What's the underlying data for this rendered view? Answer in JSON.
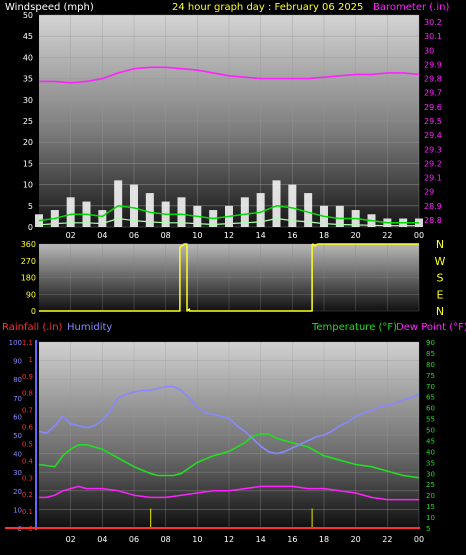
{
  "header": {
    "left": "Windspeed (mph)",
    "center": "24 hour graph day : February 06 2025",
    "right": "Barometer (.in)"
  },
  "colors": {
    "windspeed": "#ffffff",
    "wind_avg": "#00dd00",
    "wind_min": "#aaffaa",
    "barometer": "#ff22ff",
    "direction": "#ffff22",
    "rainfall": "#ff3030",
    "humidity": "#8888ff",
    "temperature": "#22dd22",
    "dewpoint": "#ff22ff",
    "rain_ticks": "#c8c800"
  },
  "chart_data": [
    {
      "type": "line",
      "title": "24 hour graph day : February 06 2025",
      "ylabel": "Windspeed (mph)",
      "y2label": "Barometer (.in)",
      "xlim": [
        0,
        24
      ],
      "ylim": [
        0,
        50
      ],
      "y2lim": [
        28.75,
        30.25
      ],
      "x_ticks": [
        "02",
        "04",
        "06",
        "08",
        "10",
        "12",
        "14",
        "16",
        "18",
        "20",
        "22",
        "00"
      ],
      "y_ticks": [
        0,
        5,
        10,
        15,
        20,
        25,
        30,
        35,
        40,
        45,
        50
      ],
      "y2_ticks": [
        "28.8",
        "28.9",
        "29",
        "29.1",
        "29.2",
        "29.3",
        "29.4",
        "29.5",
        "29.6",
        "29.7",
        "29.8",
        "29.9",
        "30",
        "30.1",
        "30.2"
      ],
      "grid": true,
      "series": [
        {
          "name": "Windspeed (mph)",
          "axis": "y",
          "style": "bars",
          "x": [
            0,
            1,
            2,
            3,
            4,
            5,
            6,
            7,
            8,
            9,
            10,
            11,
            12,
            13,
            14,
            15,
            16,
            17,
            18,
            19,
            20,
            21,
            22,
            23,
            24
          ],
          "values": [
            3,
            4,
            7,
            6,
            4,
            11,
            10,
            8,
            6,
            7,
            5,
            4,
            5,
            7,
            8,
            11,
            10,
            8,
            5,
            5,
            4,
            3,
            2,
            2,
            2
          ]
        },
        {
          "axis": "y",
          "style": "line",
          "x": [
            0,
            1,
            2,
            3,
            4,
            5,
            6,
            7,
            8,
            9,
            10,
            11,
            12,
            13,
            14,
            15,
            16,
            17,
            18,
            19,
            20,
            21,
            22,
            23,
            24
          ],
          "values": [
            1.5,
            2,
            3,
            3,
            2.5,
            5,
            4.5,
            3.5,
            3,
            3,
            2.5,
            2,
            2.5,
            3,
            3.5,
            5,
            4.5,
            3.5,
            2.5,
            2,
            2,
            1.5,
            1,
            1,
            1
          ]
        },
        {
          "axis": "y",
          "style": "line",
          "x": [
            0,
            1,
            2,
            3,
            4,
            5,
            6,
            7,
            8,
            9,
            10,
            11,
            12,
            13,
            14,
            15,
            16,
            17,
            18,
            19,
            20,
            21,
            22,
            23,
            24
          ],
          "values": [
            0.5,
            0.8,
            1,
            1,
            0.8,
            2,
            1.5,
            1.2,
            1,
            1,
            0.8,
            0.6,
            0.8,
            1,
            1.2,
            2,
            1.5,
            1.2,
            0.8,
            0.6,
            0.5,
            0.4,
            0.3,
            0.3,
            0.3
          ]
        },
        {
          "name": "Barometer (.in)",
          "axis": "y2",
          "style": "line",
          "x": [
            0,
            1,
            2,
            3,
            4,
            5,
            6,
            7,
            8,
            9,
            10,
            11,
            12,
            13,
            14,
            15,
            16,
            17,
            18,
            19,
            20,
            21,
            22,
            23,
            24
          ],
          "values": [
            29.78,
            29.78,
            29.77,
            29.78,
            29.8,
            29.84,
            29.87,
            29.88,
            29.88,
            29.87,
            29.86,
            29.84,
            29.82,
            29.81,
            29.8,
            29.8,
            29.8,
            29.8,
            29.81,
            29.82,
            29.83,
            29.83,
            29.84,
            29.84,
            29.83
          ]
        }
      ]
    },
    {
      "type": "line",
      "xlim": [
        0,
        24
      ],
      "ylim": [
        0,
        360
      ],
      "y_ticks": [
        0,
        90,
        180,
        270,
        360
      ],
      "compass_labels": [
        "N",
        "W",
        "S",
        "E",
        "N"
      ],
      "grid": true,
      "series": [
        {
          "axis": "y",
          "style": "step",
          "x": [
            0,
            8.9,
            8.9,
            9.0,
            9.15,
            9.15,
            9.35,
            9.35,
            9.5,
            9.5,
            17.25,
            17.25,
            17.3,
            17.4,
            17.6,
            17.6,
            24
          ],
          "values": [
            0,
            0,
            340,
            350,
            355,
            360,
            360,
            0,
            10,
            0,
            0,
            355,
            360,
            350,
            360,
            360,
            360
          ]
        }
      ]
    },
    {
      "type": "line",
      "xlim": [
        0,
        24
      ],
      "x_ticks": [
        "02",
        "04",
        "06",
        "08",
        "10",
        "12",
        "14",
        "16",
        "18",
        "20",
        "22",
        "00"
      ],
      "rain_label": "Rainfall (.in)",
      "humidity_label": "Humidity",
      "temp_label": "Temperature (°F)",
      "dew_label": "Dew Point (°F)",
      "rain_ylim": [
        0,
        1.1
      ],
      "rain_ticks": [
        "0",
        "0.1",
        "0.2",
        "0.3",
        "0.4",
        "0.5",
        "0.6",
        "0.7",
        "0.8",
        "0.9",
        "1",
        "1.1"
      ],
      "hum_ylim": [
        0,
        100
      ],
      "hum_ticks": [
        0,
        10,
        20,
        30,
        40,
        50,
        60,
        70,
        80,
        90,
        100
      ],
      "temp_ylim": [
        5,
        90
      ],
      "temp_ticks": [
        5,
        10,
        15,
        20,
        25,
        30,
        35,
        40,
        45,
        50,
        55,
        60,
        65,
        70,
        75,
        80,
        85,
        90
      ],
      "grid": true,
      "series": [
        {
          "name": "Humidity",
          "axis": "humidity",
          "style": "line",
          "x": [
            0,
            0.5,
            1,
            1.5,
            2,
            2.5,
            3,
            3.5,
            4,
            4.5,
            5,
            5.5,
            6,
            6.5,
            7,
            7.5,
            8,
            8.5,
            9,
            9.5,
            10,
            10.5,
            11,
            11.5,
            12,
            12.5,
            13,
            13.5,
            14,
            14.5,
            15,
            15.5,
            16,
            16.5,
            17,
            17.5,
            18,
            18.5,
            19,
            19.5,
            20,
            20.5,
            21,
            21.5,
            22,
            22.5,
            23,
            23.5,
            24
          ],
          "values": [
            52,
            51,
            55,
            60,
            56,
            55,
            54,
            55,
            58,
            63,
            70,
            72,
            73,
            74,
            74,
            75,
            76,
            76,
            74,
            70,
            65,
            62,
            61,
            60,
            59,
            55,
            52,
            48,
            44,
            41,
            40,
            41,
            43,
            45,
            47,
            49,
            50,
            52,
            55,
            57,
            60,
            62,
            63,
            65,
            66,
            67,
            69,
            70,
            72
          ]
        },
        {
          "name": "Temperature (°F)",
          "axis": "temp",
          "style": "line",
          "x": [
            0,
            1,
            1.5,
            2,
            2.5,
            3,
            4,
            5,
            6,
            7,
            7.5,
            8,
            8.5,
            9,
            10,
            11,
            12,
            13,
            13.5,
            14,
            14.5,
            15,
            16,
            17,
            18,
            19,
            20,
            21,
            22,
            23,
            24
          ],
          "values": [
            34,
            33,
            38,
            41,
            43,
            43,
            41,
            37,
            33,
            30,
            29,
            29,
            29,
            30,
            35,
            38,
            40,
            44,
            47,
            48,
            48,
            46,
            44,
            42,
            38,
            36,
            34,
            33,
            31,
            29,
            28
          ]
        },
        {
          "name": "Dew Point (°F)",
          "axis": "temp",
          "style": "line",
          "x": [
            0,
            0.5,
            1,
            1.5,
            2,
            2.5,
            3,
            4,
            5,
            6,
            7,
            8,
            9,
            10,
            11,
            12,
            13,
            14,
            15,
            16,
            17,
            18,
            19,
            20,
            21,
            22,
            23,
            24
          ],
          "values": [
            19,
            19,
            20,
            22,
            23,
            24,
            23,
            23,
            22,
            20,
            19,
            19,
            20,
            21,
            22,
            22,
            23,
            24,
            24,
            24,
            23,
            23,
            22,
            21,
            19,
            18,
            18,
            18
          ]
        },
        {
          "name": "Rainfall (.in)",
          "axis": "rain",
          "style": "line",
          "x": [
            0,
            24
          ],
          "values": [
            0,
            0
          ]
        }
      ],
      "rain_events": [
        {
          "x": 7.05,
          "value": 0.08
        },
        {
          "x": 17.25,
          "value": 0.08
        }
      ]
    }
  ]
}
